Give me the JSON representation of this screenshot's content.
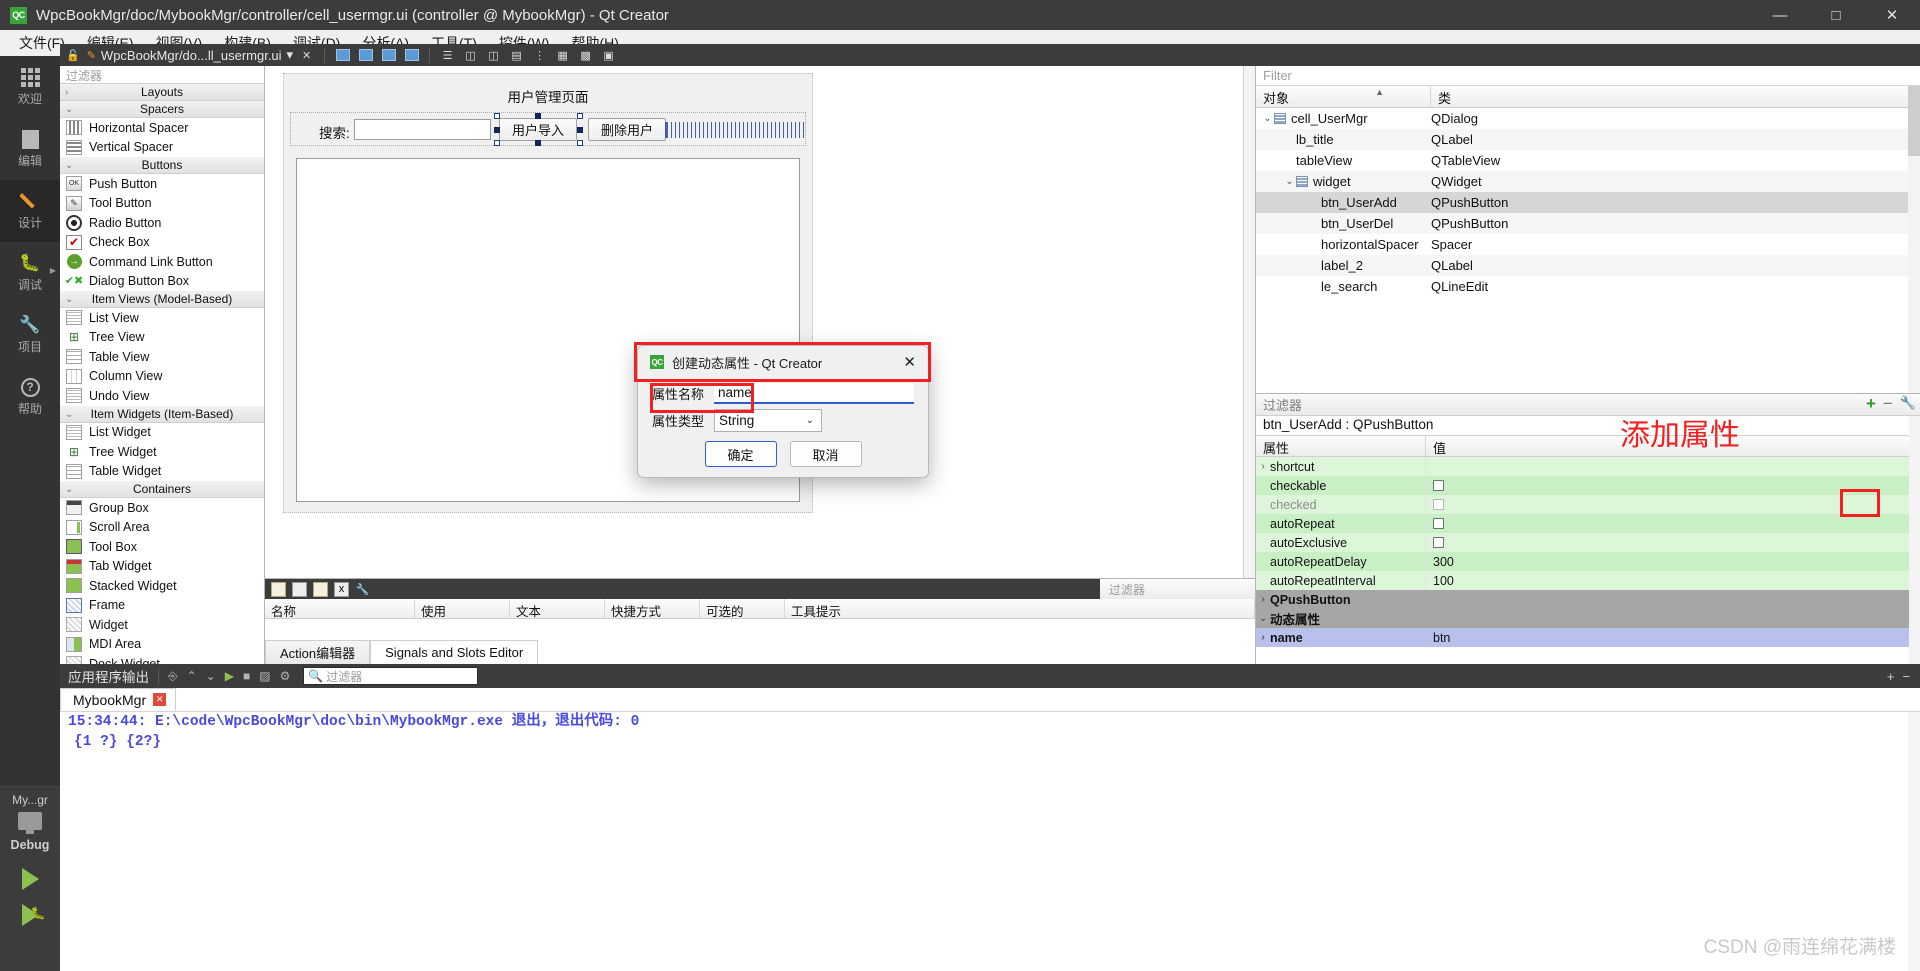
{
  "window": {
    "title": "WpcBookMgr/doc/MybookMgr/controller/cell_usermgr.ui (controller @ MybookMgr) - Qt Creator",
    "app_icon": "QC",
    "minimize": "─",
    "maximize": "☐",
    "close": "✕"
  },
  "menubar": {
    "items": [
      {
        "label": "文件(F)"
      },
      {
        "label": "编辑(E)"
      },
      {
        "label": "视图(V)"
      },
      {
        "label": "构建(B)"
      },
      {
        "label": "调试(D)"
      },
      {
        "label": "分析(A)"
      },
      {
        "label": "工具(T)"
      },
      {
        "label": "控件(W)"
      },
      {
        "label": "帮助(H)"
      }
    ]
  },
  "modebar": {
    "items": [
      {
        "label": "欢迎",
        "icon": "grid-icon"
      },
      {
        "label": "编辑",
        "icon": "document-icon"
      },
      {
        "label": "设计",
        "icon": "pencil-icon"
      },
      {
        "label": "调试",
        "icon": "bug-icon"
      },
      {
        "label": "项目",
        "icon": "wrench-icon"
      },
      {
        "label": "帮助",
        "icon": "question-icon"
      }
    ],
    "kit": {
      "project": "My...gr",
      "build_config": "Debug",
      "monitor_icon": "monitor-icon",
      "run_icon": "run-triangle-icon",
      "debug_icon": "debug-triangle-icon"
    }
  },
  "designer_toolbar": {
    "lock_icon": "lock-icon",
    "file_label": "WpcBookMgr/do...ll_usermgr.ui",
    "dropdown_icon": "chevron-down-icon",
    "close_icon": "close-icon",
    "buttons": [
      "edit-widgets-icon",
      "edit-signals-icon",
      "edit-buddies-icon",
      "edit-tab-order-icon",
      "layout-horizontal-icon",
      "layout-vertical-icon",
      "layout-splitter-h-icon",
      "layout-splitter-v-icon",
      "layout-form-icon",
      "layout-grid-icon",
      "break-layout-icon",
      "adjust-size-icon"
    ]
  },
  "widgetbox": {
    "filter_placeholder": "过滤器",
    "groups": [
      {
        "name": "Layouts",
        "collapsed": true,
        "items": []
      },
      {
        "name": "Spacers",
        "collapsed": false,
        "items": [
          {
            "label": "Horizontal Spacer",
            "icon": "horizontal-spacer-icon",
            "cls": "ico-hspacer"
          },
          {
            "label": "Vertical Spacer",
            "icon": "vertical-spacer-icon",
            "cls": "ico-vspacer"
          }
        ]
      },
      {
        "name": "Buttons",
        "collapsed": false,
        "items": [
          {
            "label": "Push Button",
            "icon": "push-button-icon",
            "cls": "ico-push",
            "glyph": "OK"
          },
          {
            "label": "Tool Button",
            "icon": "tool-button-icon",
            "cls": "ico-tool",
            "glyph": "✐"
          },
          {
            "label": "Radio Button",
            "icon": "radio-button-icon",
            "cls": "ico-radio"
          },
          {
            "label": "Check Box",
            "icon": "check-box-icon",
            "cls": "ico-check",
            "glyph": "✔"
          },
          {
            "label": "Command Link Button",
            "icon": "command-link-button-icon",
            "cls": "ico-cmd"
          },
          {
            "label": "Dialog Button Box",
            "icon": "dialog-button-box-icon",
            "cls": "ico-dbb",
            "glyph": "✔✖"
          }
        ]
      },
      {
        "name": "Item Views (Model-Based)",
        "collapsed": false,
        "items": [
          {
            "label": "List View",
            "icon": "list-view-icon",
            "cls": "ico-list"
          },
          {
            "label": "Tree View",
            "icon": "tree-view-icon",
            "cls": "ico-tree"
          },
          {
            "label": "Table View",
            "icon": "table-view-icon",
            "cls": "ico-table"
          },
          {
            "label": "Column View",
            "icon": "column-view-icon",
            "cls": "ico-column"
          },
          {
            "label": "Undo View",
            "icon": "undo-view-icon",
            "cls": "ico-undo"
          }
        ]
      },
      {
        "name": "Item Widgets (Item-Based)",
        "collapsed": false,
        "items": [
          {
            "label": "List Widget",
            "icon": "list-widget-icon",
            "cls": "ico-list"
          },
          {
            "label": "Tree Widget",
            "icon": "tree-widget-icon",
            "cls": "ico-tree"
          },
          {
            "label": "Table Widget",
            "icon": "table-widget-icon",
            "cls": "ico-table"
          }
        ]
      },
      {
        "name": "Containers",
        "collapsed": false,
        "items": [
          {
            "label": "Group Box",
            "icon": "group-box-icon",
            "cls": "ico-group"
          },
          {
            "label": "Scroll Area",
            "icon": "scroll-area-icon",
            "cls": "ico-scroll"
          },
          {
            "label": "Tool Box",
            "icon": "tool-box-icon",
            "cls": "ico-toolbox"
          },
          {
            "label": "Tab Widget",
            "icon": "tab-widget-icon",
            "cls": "ico-tab"
          },
          {
            "label": "Stacked Widget",
            "icon": "stacked-widget-icon",
            "cls": "ico-stacked"
          },
          {
            "label": "Frame",
            "icon": "frame-icon",
            "cls": "ico-frame"
          },
          {
            "label": "Widget",
            "icon": "widget-icon",
            "cls": "ico-widget"
          },
          {
            "label": "MDI Area",
            "icon": "mdi-area-icon",
            "cls": "ico-mdi"
          },
          {
            "label": "Dock Widget",
            "icon": "dock-widget-icon",
            "cls": "ico-widget"
          }
        ]
      }
    ]
  },
  "canvas": {
    "form_title": "用户管理页面",
    "search_label": "搜索:",
    "search_value": "",
    "btn_import": "用户导入",
    "btn_delete": "删除用户"
  },
  "action_editor": {
    "filter_placeholder": "过滤器",
    "columns": [
      "名称",
      "使用",
      "文本",
      "快捷方式",
      "可选的",
      "工具提示"
    ],
    "rows": [],
    "tabs": [
      {
        "label": "Action编辑器",
        "active": false
      },
      {
        "label": "Signals and Slots Editor",
        "active": true
      }
    ]
  },
  "object_inspector": {
    "filter_placeholder": "Filter",
    "columns": [
      "对象",
      "类"
    ],
    "rows": [
      {
        "name": "cell_UserMgr",
        "cls": "QDialog",
        "indent": 0,
        "expander": "∨",
        "has_icon": true,
        "selected": false
      },
      {
        "name": "lb_title",
        "cls": "QLabel",
        "indent": 1,
        "expander": "",
        "has_icon": false,
        "selected": false
      },
      {
        "name": "tableView",
        "cls": "QTableView",
        "indent": 1,
        "expander": "",
        "has_icon": false,
        "selected": false
      },
      {
        "name": "widget",
        "cls": "QWidget",
        "indent": 1,
        "expander": "∨",
        "has_icon": true,
        "selected": false
      },
      {
        "name": "btn_UserAdd",
        "cls": "QPushButton",
        "indent": 2,
        "expander": "",
        "has_icon": false,
        "selected": true
      },
      {
        "name": "btn_UserDel",
        "cls": "QPushButton",
        "indent": 2,
        "expander": "",
        "has_icon": false,
        "selected": false
      },
      {
        "name": "horizontalSpacer",
        "cls": "Spacer",
        "indent": 2,
        "expander": "",
        "has_icon": false,
        "selected": false
      },
      {
        "name": "label_2",
        "cls": "QLabel",
        "indent": 2,
        "expander": "",
        "has_icon": false,
        "selected": false
      },
      {
        "name": "le_search",
        "cls": "QLineEdit",
        "indent": 2,
        "expander": "",
        "has_icon": false,
        "selected": false
      }
    ]
  },
  "property_editor": {
    "filter_placeholder": "过滤器",
    "object_line": "btn_UserAdd : QPushButton",
    "columns": [
      "属性",
      "值"
    ],
    "add_icon": "plus-icon",
    "remove_icon": "minus-icon",
    "config_icon": "wrench-icon",
    "rows": [
      {
        "name": "shortcut",
        "value": "",
        "kind": "expander",
        "style": "g2",
        "expander": "›"
      },
      {
        "name": "checkable",
        "value": "",
        "kind": "checkbox",
        "style": "g1"
      },
      {
        "name": "checked",
        "value": "",
        "kind": "checkbox",
        "style": "g2",
        "disabled": true
      },
      {
        "name": "autoRepeat",
        "value": "",
        "kind": "checkbox",
        "style": "g1"
      },
      {
        "name": "autoExclusive",
        "value": "",
        "kind": "checkbox",
        "style": "g2"
      },
      {
        "name": "autoRepeatDelay",
        "value": "300",
        "kind": "text",
        "style": "g1"
      },
      {
        "name": "autoRepeatInterval",
        "value": "100",
        "kind": "text",
        "style": "g2"
      },
      {
        "name": "QPushButton",
        "value": "",
        "kind": "group",
        "style": "grey",
        "expander": "›"
      },
      {
        "name": "动态属性",
        "value": "",
        "kind": "group",
        "style": "grey",
        "expander": "∨"
      },
      {
        "name": "name",
        "value": "btn",
        "kind": "text",
        "style": "blue",
        "expander": "›"
      }
    ]
  },
  "dialog": {
    "icon": "QC",
    "title": "创建动态属性 - Qt Creator",
    "close_icon": "✕",
    "name_label": "属性名称",
    "name_value": "name",
    "type_label": "属性类型",
    "type_value": "String",
    "type_chevron": "∨",
    "ok_label": "确定",
    "cancel_label": "取消"
  },
  "output_pane": {
    "title": "应用程序输出",
    "filter_placeholder": "过滤器",
    "search_icon": "search-icon",
    "toolbar_icons": [
      "link-icon",
      "up-arrow-icon",
      "down-arrow-icon",
      "play-icon",
      "stop-icon",
      "attach-icon",
      "gear-icon"
    ],
    "add_icon": "+",
    "remove_icon": "−",
    "tab_label": "MybookMgr",
    "tab_close": "✕",
    "lines": [
      "15:34:44: E:\\code\\WpcBookMgr\\doc\\bin\\MybookMgr.exe 退出，退出代码: 0",
      "{1 ?} {2?}"
    ]
  },
  "annotations": {
    "add_property": "添加属性",
    "property_name": "属性名"
  },
  "watermark": "CSDN @雨连绵花满楼",
  "colors": {
    "accent_red": "#f22020",
    "qt_green": "#3aa33a",
    "prop_green": "#c9f0c5",
    "prop_blue": "#b9c0ec",
    "dark_chrome": "#3c3c3c"
  }
}
